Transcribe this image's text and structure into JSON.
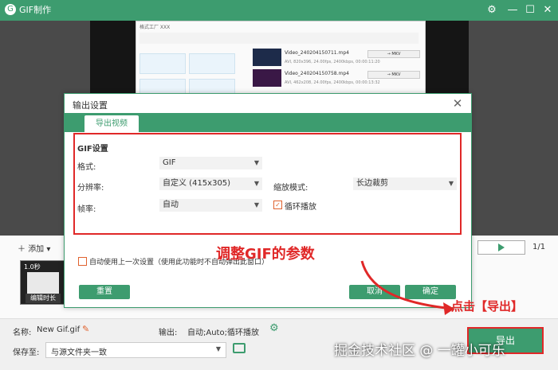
{
  "titlebar": {
    "app_title": "GIF制作"
  },
  "inner_app": {
    "title": "格式工厂 XXX",
    "files": [
      {
        "name": "Video_240204150711.mp4",
        "info": "AVI, 820x396, 24.00fps, 2400kbps, 00:00:11:20",
        "target": "→ MKV"
      },
      {
        "name": "Video_240204150758.mp4",
        "info": "AVI, 462x208, 24.00fps, 2400kbps, 00:00:13:32",
        "target": "→ MKV"
      }
    ]
  },
  "dialog": {
    "title": "输出设置",
    "tab_export_video": "导出视频",
    "section_title": "GIF设置",
    "format_label": "格式:",
    "format_value": "GIF",
    "resolution_label": "分辨率:",
    "resolution_value": "自定义 (415x305)",
    "zoom_label": "缩放模式:",
    "zoom_value": "长边裁剪",
    "framerate_label": "帧率:",
    "framerate_value": "自动",
    "loop_label": "循环播放",
    "use_last_label": "自动使用上一次设置（使用此功能时不自动弹出此窗口）",
    "reset_button": "重置",
    "cancel_button": "取消",
    "ok_button": "确定"
  },
  "annotation": {
    "adjust_params": "调整GIF的参数",
    "click_export": "点击【导出】"
  },
  "timeline": {
    "add_button": "添加",
    "page_indicator": "1/1",
    "clip_duration_label": "1.0秒",
    "clip_edit_label": "编辑时长"
  },
  "statusbar": {
    "name_label": "名称:",
    "name_value": "New Gif.gif",
    "output_label": "输出:",
    "output_value": "自动;Auto;循环播放",
    "saveto_label": "保存至:",
    "saveto_value": "与源文件夹一致",
    "export_button": "导出"
  },
  "watermark": "掘金技术社区 @ 一罐小可乐",
  "colors": {
    "accent": "#3d9c6f",
    "annotation": "#e02828"
  }
}
